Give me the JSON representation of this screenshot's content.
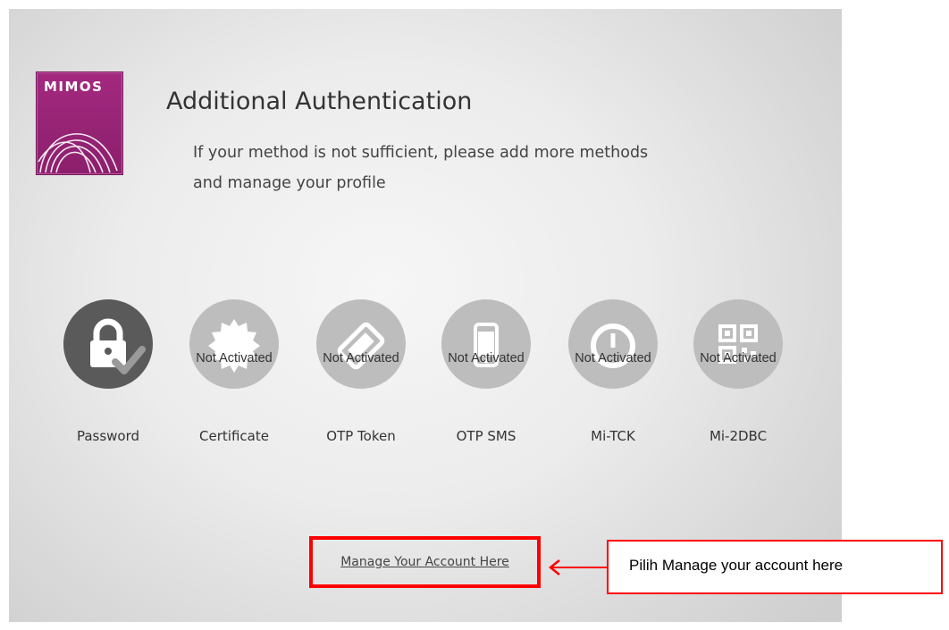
{
  "logo": {
    "text": "MIMOS"
  },
  "header": {
    "title": "Additional Authentication",
    "subtitle_line1": "If your method is not sufficient, please add more methods",
    "subtitle_line2": "and manage your profile"
  },
  "methods": [
    {
      "label": "Password",
      "status": "",
      "icon": "lock-check-icon",
      "active": true
    },
    {
      "label": "Certificate",
      "status": "Not Activated",
      "icon": "certificate-seal-icon",
      "active": false
    },
    {
      "label": "OTP Token",
      "status": "Not Activated",
      "icon": "token-icon",
      "active": false
    },
    {
      "label": "OTP SMS",
      "status": "Not Activated",
      "icon": "phone-icon",
      "active": false
    },
    {
      "label": "Mi-TCK",
      "status": "Not Activated",
      "icon": "timer-icon",
      "active": false
    },
    {
      "label": "Mi-2DBC",
      "status": "Not Activated",
      "icon": "qr-code-icon",
      "active": false
    }
  ],
  "manage_link": {
    "label": "Manage Your Account Here"
  },
  "annotation": {
    "text": "Pilih Manage your account here"
  },
  "colors": {
    "annotation_red": "#ff0000",
    "logo_purple": "#a3297f",
    "active_circle": "#5a5a5a",
    "inactive_circle": "#bdbdbd"
  }
}
